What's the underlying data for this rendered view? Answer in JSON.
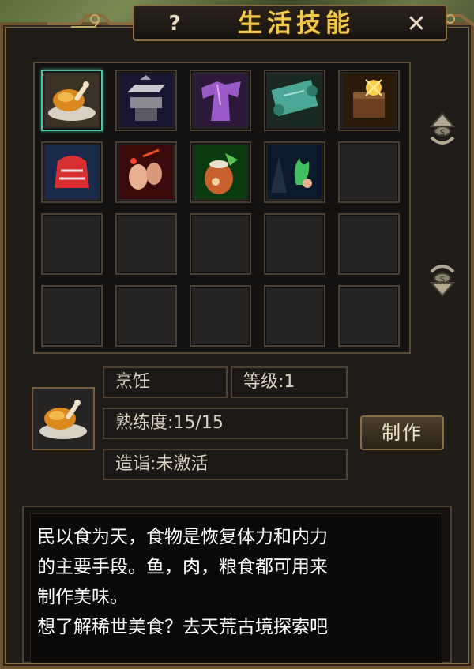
{
  "window": {
    "title": "生活技能",
    "help_label": "?",
    "close_label": "✕"
  },
  "skills": [
    {
      "icon": "roast-chicken-icon",
      "selected": true
    },
    {
      "icon": "anvil-icon",
      "selected": false
    },
    {
      "icon": "robe-icon",
      "selected": false
    },
    {
      "icon": "scroll-icon",
      "selected": false
    },
    {
      "icon": "treasure-chest-icon",
      "selected": false
    },
    {
      "icon": "silk-gown-icon",
      "selected": false
    },
    {
      "icon": "crafting-hands-icon",
      "selected": false
    },
    {
      "icon": "medicine-jar-icon",
      "selected": false
    },
    {
      "icon": "herb-gathering-icon",
      "selected": false
    }
  ],
  "detail": {
    "skill_name": "烹饪",
    "level_text": "等级:1",
    "proficiency_text": "熟练度:15/15",
    "mastery_text": "造诣:未激活",
    "make_button": "制作"
  },
  "description": {
    "lines": [
      "民以食为天，食物是恢复体力和内力",
      "的主要手段。鱼，肉，粮食都可用来",
      "制作美味。",
      "想了解稀世美食？去天荒古境探索吧"
    ]
  },
  "colors": {
    "title_gold": "#f2c94a",
    "frame_bronze": "#8a6c3e",
    "selected_teal": "#4fc3a8"
  }
}
